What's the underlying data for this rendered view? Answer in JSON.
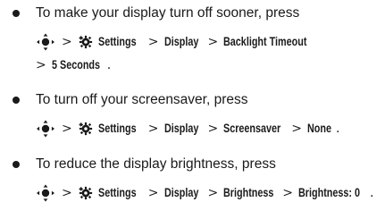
{
  "items": [
    {
      "intro": "To make your display turn off sooner, press",
      "path": {
        "sep": ">",
        "settings": "Settings",
        "display": "Display",
        "target": "Backlight Timeout",
        "value": "5 Seconds",
        "end": "."
      }
    },
    {
      "intro": "To turn off your screensaver, press",
      "path": {
        "sep": ">",
        "settings": "Settings",
        "display": "Display",
        "target": "Screensaver",
        "value": "None",
        "end": "."
      }
    },
    {
      "intro": "To reduce the display brightness, press",
      "path": {
        "sep": ">",
        "settings": "Settings",
        "display": "Display",
        "target": "Brightness",
        "value": "Brightness: 0",
        "end": "."
      }
    }
  ],
  "icons": {
    "nav": "nav-key-icon",
    "settings": "settings-gear-icon"
  }
}
